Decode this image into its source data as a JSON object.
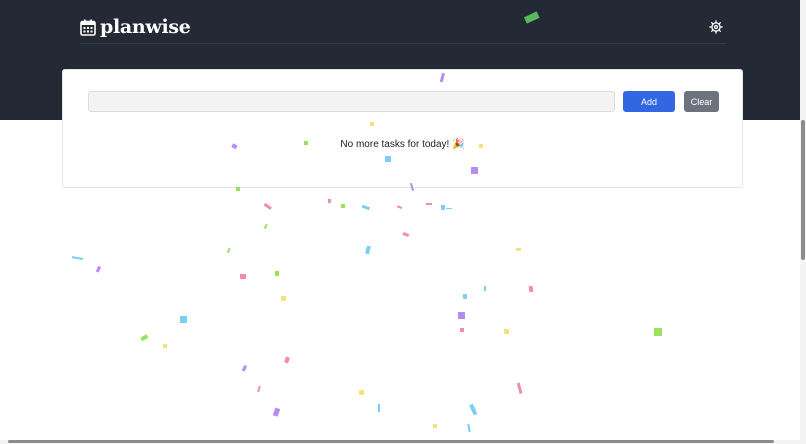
{
  "header": {
    "brand_name": "planwise",
    "brand_icon": "calendar-icon",
    "settings_icon": "gear-icon"
  },
  "task_form": {
    "input_value": "",
    "input_placeholder": "",
    "add_label": "Add",
    "clear_label": "Clear"
  },
  "task_list": {
    "empty_message": "No more tasks for today! 🎉"
  },
  "colors": {
    "header_bg": "#232a36",
    "add_button": "#3266e2",
    "clear_button": "#6c737f",
    "confetti": [
      "#5cb85c",
      "#b48cf2",
      "#f6e27a",
      "#7ccff4",
      "#f48ca3",
      "#9be15d"
    ]
  }
}
